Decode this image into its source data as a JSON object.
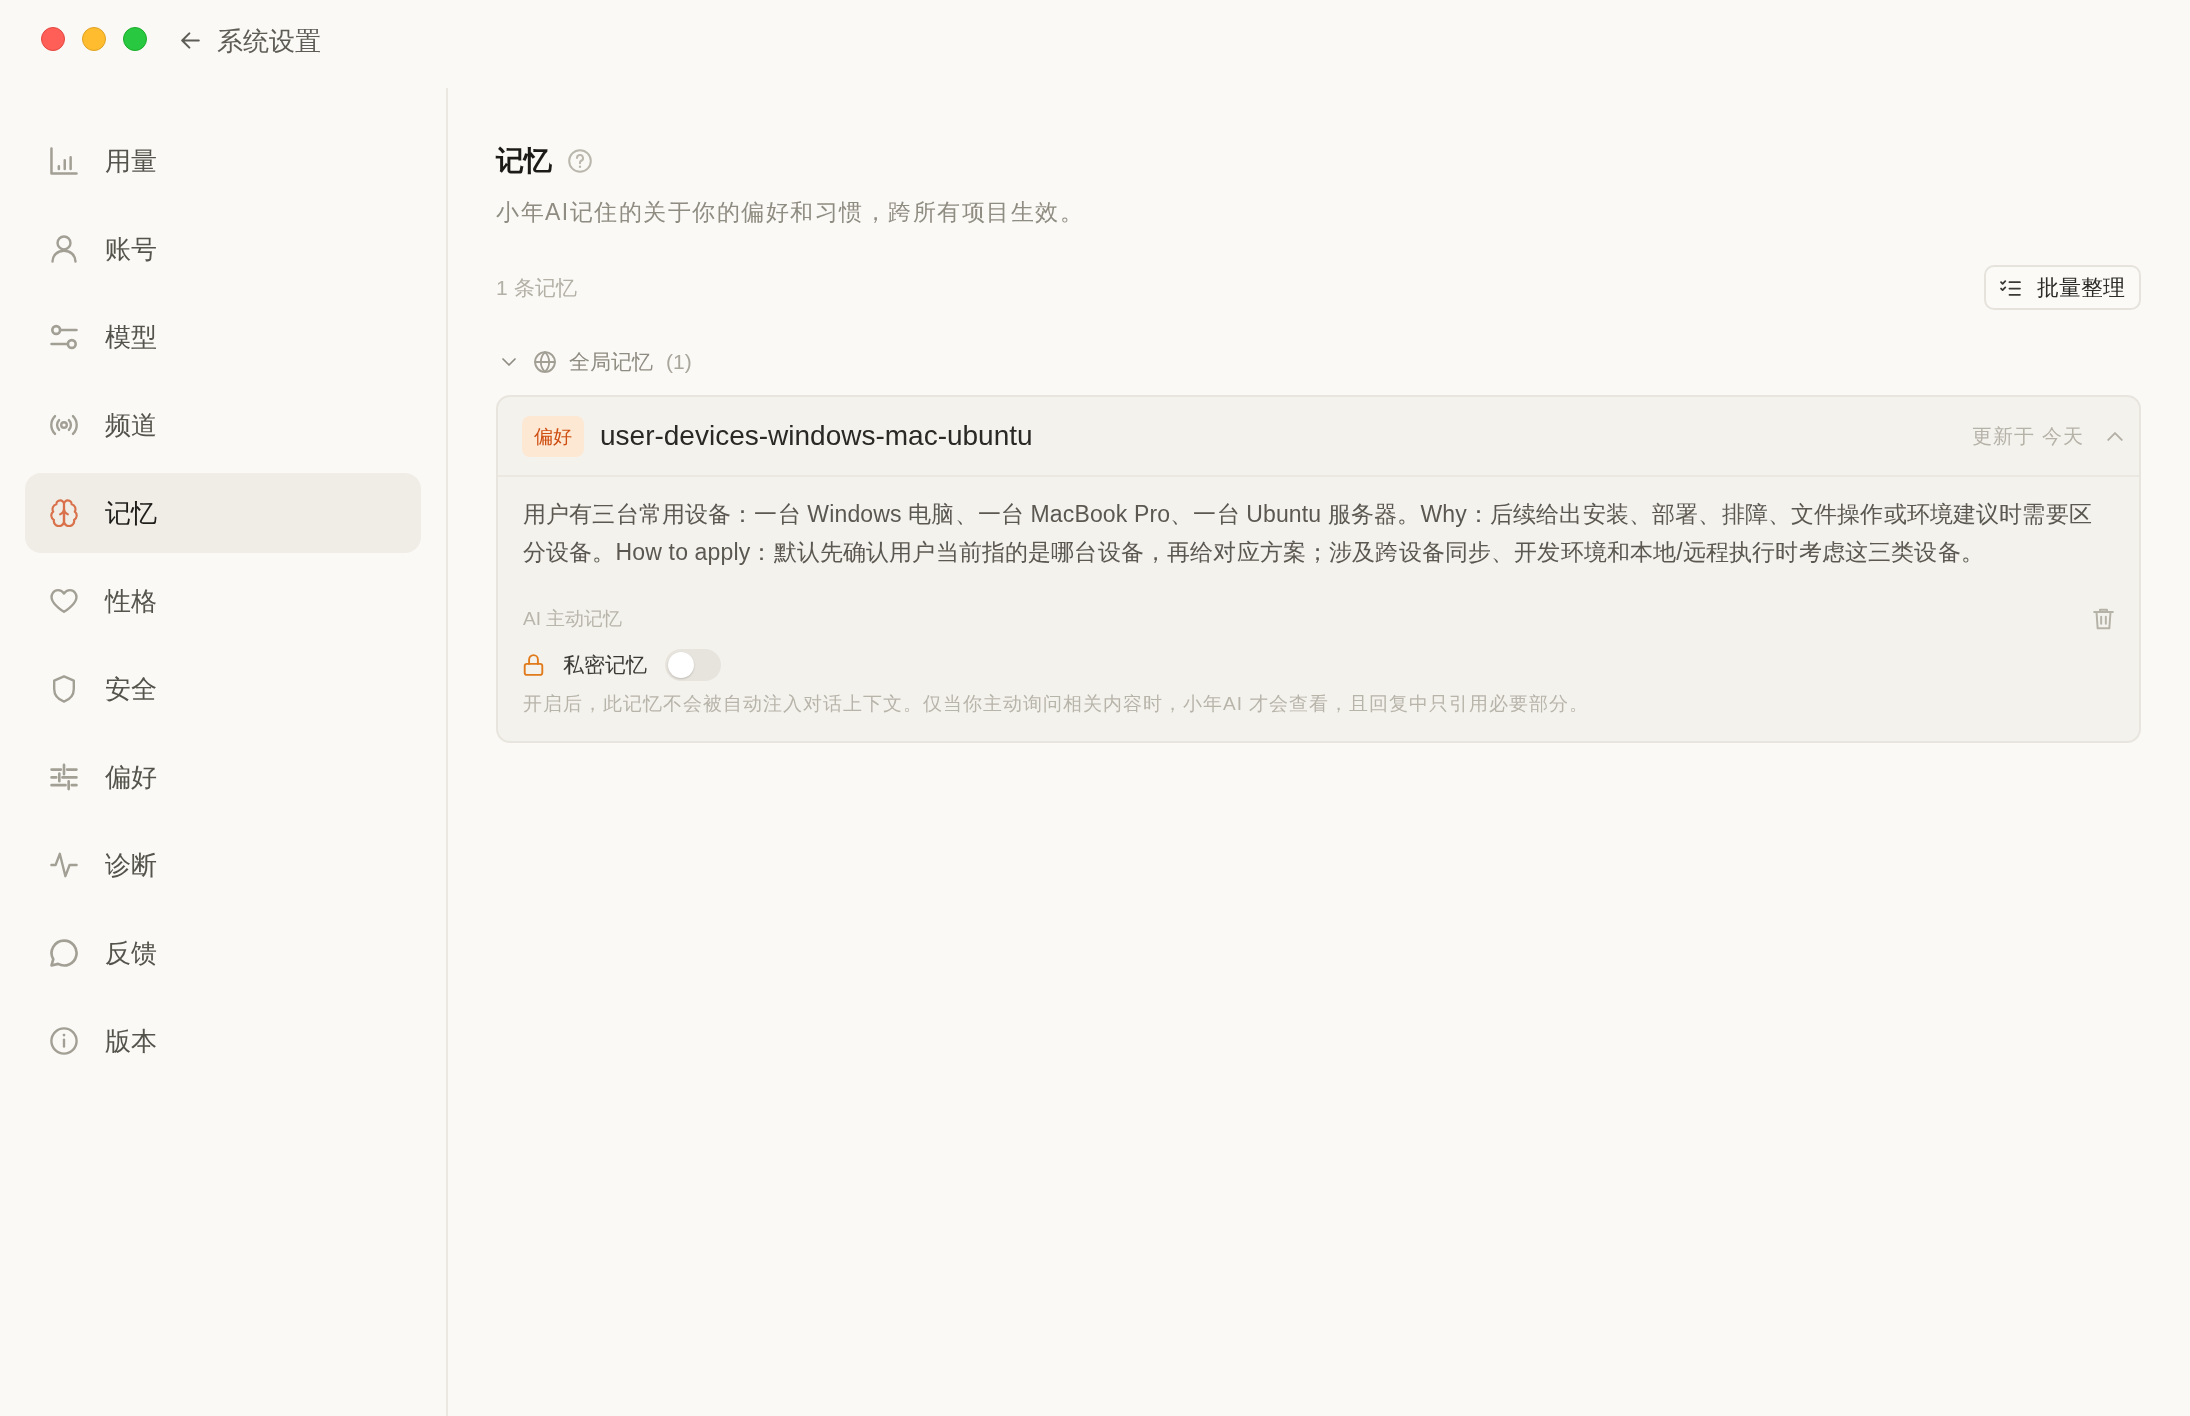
{
  "window": {
    "title": "系统设置"
  },
  "sidebar": {
    "items": [
      {
        "label": "用量",
        "selected": false
      },
      {
        "label": "账号",
        "selected": false
      },
      {
        "label": "模型",
        "selected": false
      },
      {
        "label": "频道",
        "selected": false
      },
      {
        "label": "记忆",
        "selected": true
      },
      {
        "label": "性格",
        "selected": false
      },
      {
        "label": "安全",
        "selected": false
      },
      {
        "label": "偏好",
        "selected": false
      },
      {
        "label": "诊断",
        "selected": false
      },
      {
        "label": "反馈",
        "selected": false
      },
      {
        "label": "版本",
        "selected": false
      }
    ]
  },
  "page": {
    "title": "记忆",
    "description": "小年AI记住的关于你的偏好和习惯，跨所有项目生效。",
    "memory_count": "1 条记忆",
    "batch_button": "批量整理",
    "groups": [
      {
        "label": "全局记忆",
        "count": "(1)",
        "expanded": true,
        "memories": [
          {
            "tag": "偏好",
            "title": "user-devices-windows-mac-ubuntu",
            "updated": "更新于 今天",
            "expanded": true,
            "content": "用户有三台常用设备：一台 Windows 电脑、一台 MacBook Pro、一台 Ubuntu 服务器。Why：后续给出安装、部署、排障、文件操作或环境建议时需要区分设备。How to apply：默认先确认用户当前指的是哪台设备，再给对应方案；涉及跨设备同步、开发环境和本地/远程执行时考虑这三类设备。",
            "source": "AI 主动记忆",
            "private_label": "私密记忆",
            "private": false,
            "private_note": "开启后，此记忆不会被自动注入对话上下文。仅当你主动询问相关内容时，小年AI 才会查看，且回复中只引用必要部分。"
          }
        ]
      }
    ]
  }
}
